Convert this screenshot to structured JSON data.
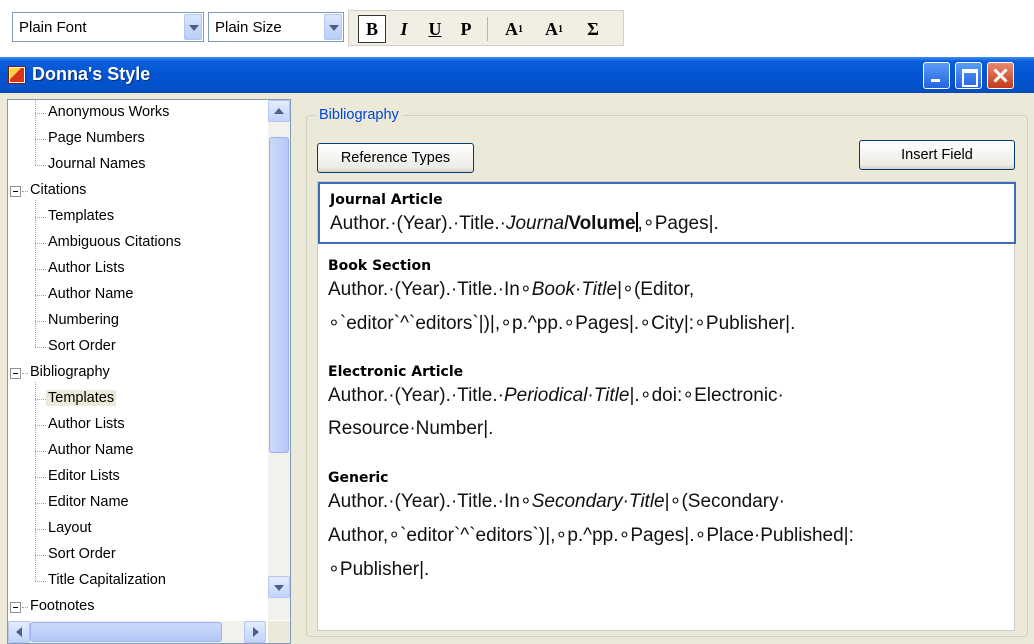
{
  "toolbar": {
    "font_value": "Plain Font",
    "size_value": "Plain Size",
    "bold": "B",
    "italic": "I",
    "underline": "U",
    "plain": "P",
    "superscript_base": "A",
    "superscript_mark": "1",
    "subscript_base": "A",
    "subscript_mark": "1",
    "symbol": "Σ"
  },
  "window": {
    "title": "Donna's Style"
  },
  "tree": {
    "items": [
      {
        "label": "Anonymous Works",
        "level": 1
      },
      {
        "label": "Page Numbers",
        "level": 1
      },
      {
        "label": "Journal Names",
        "level": 1
      },
      {
        "label": "Citations",
        "level": 0,
        "expanded": true
      },
      {
        "label": "Templates",
        "level": 1
      },
      {
        "label": "Ambiguous Citations",
        "level": 1
      },
      {
        "label": "Author Lists",
        "level": 1
      },
      {
        "label": "Author Name",
        "level": 1
      },
      {
        "label": "Numbering",
        "level": 1
      },
      {
        "label": "Sort Order",
        "level": 1
      },
      {
        "label": "Bibliography",
        "level": 0,
        "expanded": true
      },
      {
        "label": "Templates",
        "level": 1,
        "selected": true
      },
      {
        "label": "Author Lists",
        "level": 1
      },
      {
        "label": "Author Name",
        "level": 1
      },
      {
        "label": "Editor Lists",
        "level": 1
      },
      {
        "label": "Editor Name",
        "level": 1
      },
      {
        "label": "Layout",
        "level": 1
      },
      {
        "label": "Sort Order",
        "level": 1
      },
      {
        "label": "Title Capitalization",
        "level": 1
      },
      {
        "label": "Footnotes",
        "level": 0,
        "expanded": true
      }
    ]
  },
  "bibliography": {
    "group_label": "Bibliography",
    "reference_types_button": "Reference Types",
    "insert_field_button": "Insert Field",
    "templates": [
      {
        "name": "Journal Article",
        "lines": [
          [
            {
              "t": "Author.·(Year).·Title.·"
            },
            {
              "t": "Journal",
              "i": true
            },
            {
              "t": "Volume",
              "b": true
            },
            {
              "caret": true
            },
            {
              "t": ",∘Pages|."
            }
          ]
        ]
      },
      {
        "name": "Book Section",
        "lines": [
          [
            {
              "t": "Author.·(Year).·Title.·In∘"
            },
            {
              "t": "Book·Title",
              "i": true
            },
            {
              "t": "|∘(Editor,"
            }
          ],
          [
            {
              "t": "∘`editor`^`editors`|)|,∘p.^pp.∘Pages|.∘City|:∘Publisher|."
            }
          ]
        ]
      },
      {
        "name": "Electronic Article",
        "lines": [
          [
            {
              "t": "Author.·(Year).·Title.·"
            },
            {
              "t": "Periodical·Title",
              "i": true
            },
            {
              "t": "|.∘doi:∘Electronic·"
            }
          ],
          [
            {
              "t": "Resource·Number|."
            }
          ]
        ]
      },
      {
        "name": "Generic",
        "lines": [
          [
            {
              "t": "Author.·(Year).·Title.·In∘"
            },
            {
              "t": "Secondary·Title",
              "i": true
            },
            {
              "t": "|∘(Secondary·"
            }
          ],
          [
            {
              "t": "Author,∘`editor`^`editors`)|,∘p.^pp.∘Pages|.∘Place·Published|:"
            }
          ],
          [
            {
              "t": "∘Publisher|."
            }
          ]
        ]
      }
    ]
  }
}
